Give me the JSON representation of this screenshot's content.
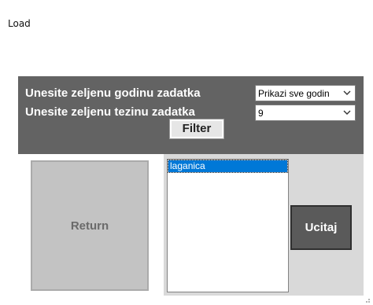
{
  "window": {
    "title": "Load"
  },
  "filter": {
    "year_label": "Unesite zeljenu godinu zadatka",
    "year_value": "Prikazi sve godin",
    "difficulty_label": "Unesite zeljenu tezinu zadatka",
    "difficulty_value": "9",
    "filter_button": "Filter"
  },
  "actions": {
    "return_button": "Return",
    "load_button": "Ucitaj"
  },
  "list": {
    "items": [
      "laganica"
    ],
    "selected_index": 0
  },
  "icons": {
    "combo_arrow": "chevron-down-icon",
    "resize_grip": "resize-grip-icon"
  },
  "colors": {
    "panel": "#636363",
    "selection": "#0078d7",
    "lower_panel": "#d9d9d9"
  }
}
